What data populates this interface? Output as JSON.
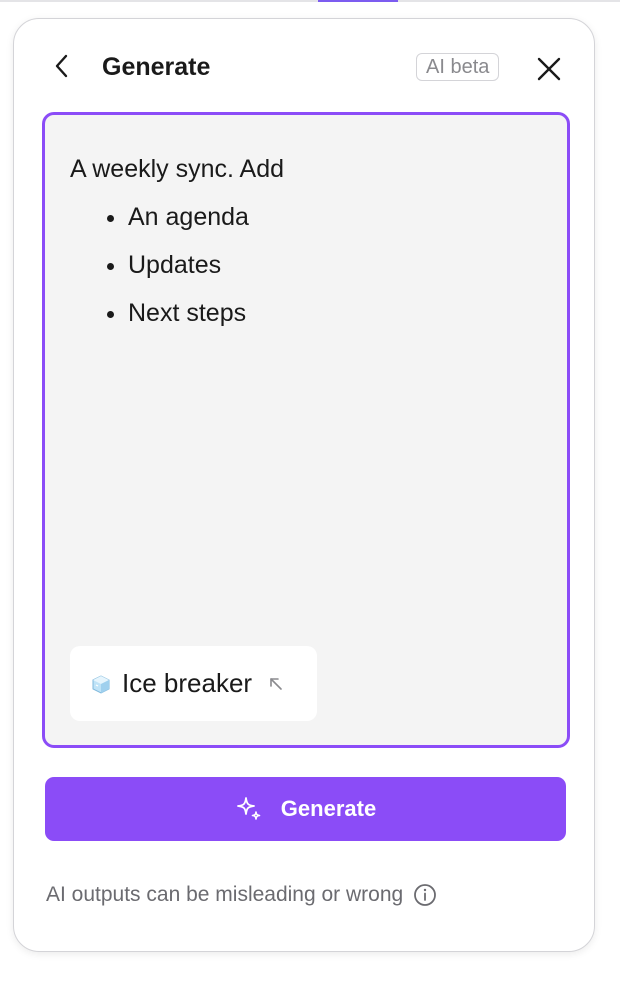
{
  "header": {
    "title": "Generate",
    "badge": "AI beta",
    "back_icon": "chevron-left-icon",
    "close_icon": "close-icon"
  },
  "prompt": {
    "intro": "A weekly sync. Add",
    "bullets": [
      "An agenda",
      "Updates",
      "Next steps"
    ]
  },
  "suggestion_chip": {
    "icon": "ice-cube-icon",
    "label": "Ice breaker",
    "action_icon": "arrow-up-left-icon"
  },
  "generate_button": {
    "label": "Generate",
    "icon": "sparkle-icon"
  },
  "footer": {
    "disclaimer": "AI outputs can be misleading or wrong",
    "info_icon": "info-icon"
  },
  "colors": {
    "accent": "#8b4cf7",
    "prompt_background": "#f4f4f4",
    "muted_text": "#6b6b70"
  }
}
